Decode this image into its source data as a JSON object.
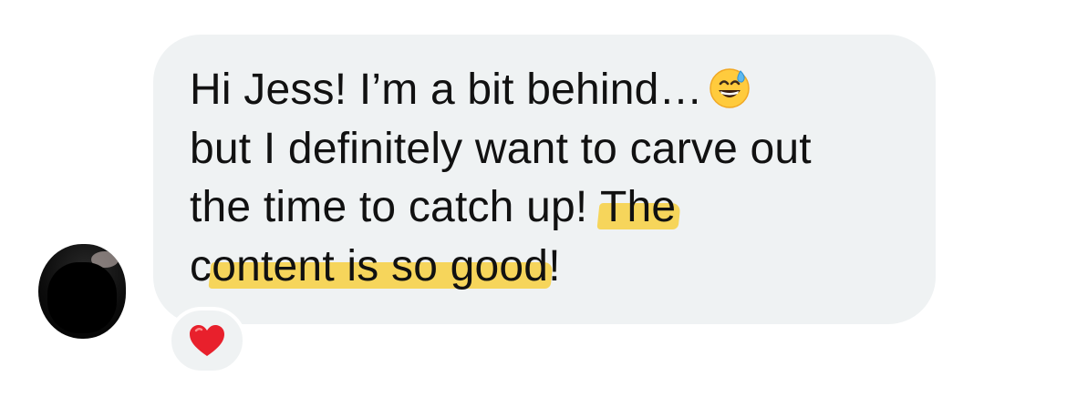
{
  "conversation": {
    "message": {
      "lines": [
        "Hi Jess! I’m a bit behind…",
        "but I definitely want to carve out",
        "the time to catch up!",
        "The",
        "c",
        "ontent is so good",
        "!"
      ],
      "emoji": "grinning-face-with-sweat-icon",
      "highlight_color": "#f6d24a",
      "bubble_color": "#eff2f3"
    },
    "reaction": {
      "emoji": "red-heart-icon",
      "color": "#e8202c"
    }
  }
}
